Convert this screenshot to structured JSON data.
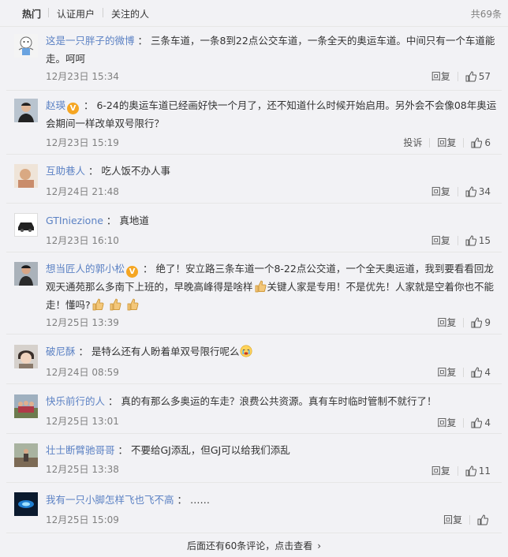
{
  "tabs": {
    "hot": "热门",
    "verified": "认证用户",
    "following": "关注的人",
    "total": "共69条"
  },
  "comments": [
    {
      "user": "这是一只胖子的微博",
      "verified": false,
      "text": "三条车道，一条8到22点公交车道，一条全天的奥运车道。中间只有一个车道能走。呵呵",
      "time": "12月23日 15:34",
      "report": "",
      "reply": "回复",
      "likes": "57",
      "avatar_icon": "cartoon-avatar-icon"
    },
    {
      "user": "赵瑛",
      "verified": true,
      "text": "6-24的奥运车道已经画好快一个月了，还不知道什么时候开始启用。另外会不会像08年奥运会期间一样改单双号限行？",
      "time": "12月23日 15:19",
      "report": "投诉",
      "reply": "回复",
      "likes": "6",
      "avatar_icon": "person-avatar-icon"
    },
    {
      "user": "互助巷人",
      "verified": false,
      "text": "吃人饭不办人事",
      "time": "12月24日 21:48",
      "report": "",
      "reply": "回复",
      "likes": "34",
      "avatar_icon": "photo-avatar-icon"
    },
    {
      "user": "GTIniezione",
      "verified": false,
      "text": "真地道",
      "time": "12月23日 16:10",
      "report": "",
      "reply": "回复",
      "likes": "15",
      "avatar_icon": "car-avatar-icon"
    },
    {
      "user": "想当匠人的郭小松",
      "verified": true,
      "text_parts": [
        "绝了！安立路三条车道一个8-22点公交道，一个全天奥运道，我到要看看回龙观天通苑那么多南下上班的，早晚高峰得是啥样",
        "关键人家是专用！不是优先！人家就是空着你也不能走！懂吗?"
      ],
      "time": "12月25日 13:39",
      "report": "",
      "reply": "回复",
      "likes": "9",
      "avatar_icon": "person-avatar-icon"
    },
    {
      "user": "破尼酥",
      "verified": false,
      "text": "是特么还有人盼着单双号限行呢么",
      "time": "12月24日 08:59",
      "report": "",
      "reply": "回复",
      "likes": "4",
      "avatar_icon": "face-avatar-icon"
    },
    {
      "user": "快乐前行的人",
      "verified": false,
      "text": "真的有那么多奥运的车走？浪费公共资源。真有车时临时管制不就行了！",
      "time": "12月25日 13:01",
      "report": "",
      "reply": "回复",
      "likes": "4",
      "avatar_icon": "group-avatar-icon"
    },
    {
      "user": "壮士断臂驰哥哥",
      "verified": false,
      "text": "不要给GJ添乱，但GJ可以给我们添乱",
      "time": "12月25日 13:38",
      "report": "",
      "reply": "回复",
      "likes": "11",
      "avatar_icon": "landscape-avatar-icon"
    },
    {
      "user": "我有一只小脚怎样飞也飞不高",
      "verified": false,
      "text": "……",
      "time": "12月25日 15:09",
      "report": "",
      "reply": "回复",
      "likes": "",
      "avatar_icon": "dark-avatar-icon"
    }
  ],
  "more": "后面还有60条评论，点击查看",
  "colors": {
    "link": "#5c82c4",
    "text": "#333333",
    "meta": "#808080",
    "badge": "#f5a623",
    "background": "#f2f2f5"
  }
}
